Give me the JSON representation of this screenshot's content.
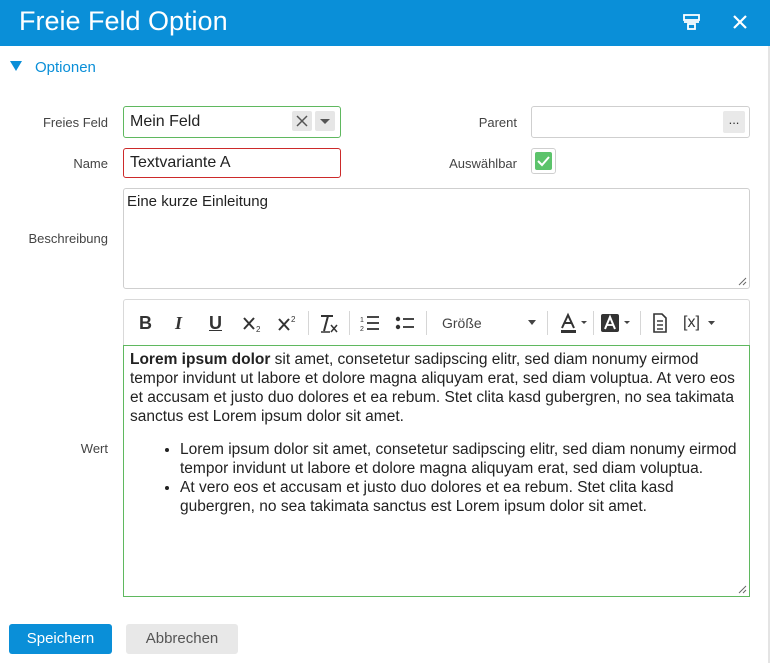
{
  "dialog": {
    "title": "Freie Feld Option"
  },
  "section": {
    "label": "Optionen"
  },
  "form": {
    "freies_feld": {
      "label": "Freies Feld",
      "value": "Mein Feld"
    },
    "parent": {
      "label": "Parent",
      "value": "",
      "button_label": "..."
    },
    "name": {
      "label": "Name",
      "value": "Textvariante A"
    },
    "auswaehlbar": {
      "label": "Auswählbar",
      "checked": true
    },
    "beschreibung": {
      "label": "Beschreibung",
      "value": "Eine kurze Einleitung"
    },
    "wert": {
      "label": "Wert",
      "toolbar": {
        "bold": "B",
        "italic": "I",
        "underline": "U",
        "size_label": "Größe",
        "variable": "[x]"
      },
      "content": {
        "paragraph_bold": "Lorem ipsum dolor",
        "paragraph_rest": " sit amet, consetetur sadipscing elitr, sed diam nonumy eirmod tempor invidunt ut labore et dolore magna aliquyam erat, sed diam voluptua. At vero eos et accusam et justo duo dolores et ea rebum. Stet clita kasd gubergren, no sea takimata sanctus est Lorem ipsum dolor sit amet.",
        "bullets": [
          "Lorem ipsum dolor sit amet, consetetur sadipscing elitr, sed diam nonumy eirmod tempor invidunt ut labore et dolore magna aliquyam erat, sed diam voluptua.",
          "At vero eos et accusam et justo duo dolores et ea rebum. Stet clita kasd gubergren, no sea takimata sanctus est Lorem ipsum dolor sit amet."
        ]
      }
    }
  },
  "buttons": {
    "save": "Speichern",
    "cancel": "Abbrechen"
  },
  "colors": {
    "primary": "#0a8fd8",
    "valid": "#5fb85f",
    "error": "#cc2a2a",
    "check": "#5cc36b"
  }
}
